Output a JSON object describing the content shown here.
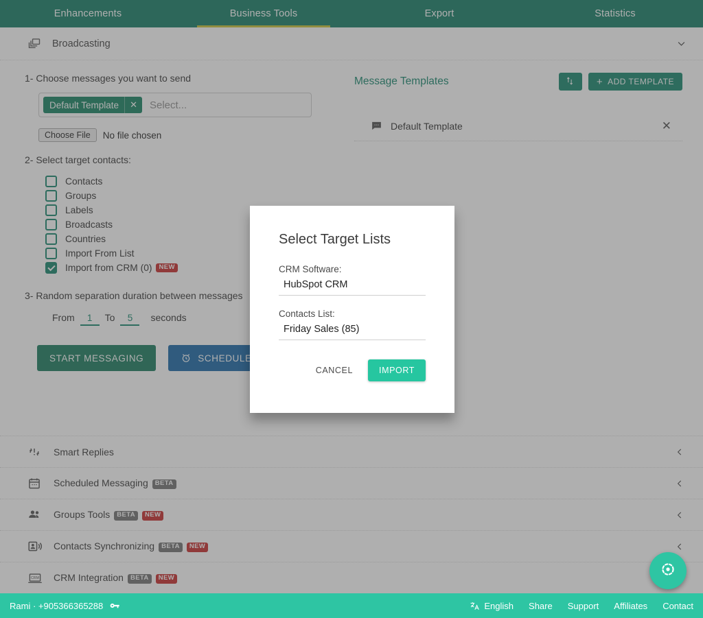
{
  "nav": {
    "tabs": [
      {
        "label": "Enhancements",
        "active": false
      },
      {
        "label": "Business Tools",
        "active": true
      },
      {
        "label": "Export",
        "active": false
      },
      {
        "label": "Statistics",
        "active": false
      }
    ]
  },
  "broadcasting": {
    "title": "Broadcasting",
    "icon": "broadcast-icon",
    "chevron": "chevron-down-icon",
    "step1_label": "1- Choose messages you want to send",
    "template_chip": "Default Template",
    "select_placeholder": "Select...",
    "choose_file_label": "Choose File",
    "no_file_text": "No file chosen",
    "step2_label": "2- Select target contacts:",
    "targets": [
      {
        "label": "Contacts",
        "checked": false,
        "badge": ""
      },
      {
        "label": "Groups",
        "checked": false,
        "badge": ""
      },
      {
        "label": "Labels",
        "checked": false,
        "badge": ""
      },
      {
        "label": "Broadcasts",
        "checked": false,
        "badge": ""
      },
      {
        "label": "Countries",
        "checked": false,
        "badge": ""
      },
      {
        "label": "Import From List",
        "checked": false,
        "badge": ""
      },
      {
        "label": "Import from CRM (0)",
        "checked": true,
        "badge": "NEW"
      }
    ],
    "step3_label": "3- Random separation duration between messages",
    "from_label": "From",
    "from_value": "1",
    "to_label": "To",
    "to_value": "5",
    "seconds_label": "seconds",
    "start_button": "START MESSAGING",
    "schedule_button": "SCHEDULE FOR LATER",
    "schedule_icon": "alarm-clock-icon"
  },
  "templates": {
    "title": "Message Templates",
    "sort_icon": "sort-arrows-icon",
    "add_label": "ADD TEMPLATE",
    "items": [
      {
        "name": "Default Template",
        "icon": "message-icon",
        "remove_icon": "close-icon"
      }
    ]
  },
  "accordions": [
    {
      "label": "Smart Replies",
      "icon": "smart-replies-icon",
      "badges": []
    },
    {
      "label": "Scheduled Messaging",
      "icon": "calendar-icon",
      "badges": [
        "BETA"
      ]
    },
    {
      "label": "Groups Tools",
      "icon": "groups-icon",
      "badges": [
        "BETA",
        "NEW"
      ]
    },
    {
      "label": "Contacts Synchronizing",
      "icon": "contact-sync-icon",
      "badges": [
        "BETA",
        "NEW"
      ]
    },
    {
      "label": "CRM Integration",
      "icon": "crm-laptop-icon",
      "badges": [
        "BETA",
        "NEW"
      ]
    }
  ],
  "modal": {
    "title": "Select Target Lists",
    "crm_label": "CRM Software:",
    "crm_value": "HubSpot CRM",
    "list_label": "Contacts List:",
    "list_value": "Friday Sales (85)",
    "cancel_label": "CANCEL",
    "import_label": "IMPORT"
  },
  "fab": {
    "icon": "adjust-target-icon"
  },
  "statusbar": {
    "user": "Rami · +905366365288",
    "key_icon": "key-icon",
    "language_icon": "translate-icon",
    "links": [
      "English",
      "Share",
      "Support",
      "Affiliates",
      "Contact"
    ]
  },
  "colors": {
    "nav_bg": "#0f7a63",
    "nav_active_underline": "#c8c232",
    "accent_green": "#12836a",
    "accent_mint": "#2ec5a3",
    "blue_button": "#1565a5",
    "badge_new": "#c62828",
    "badge_beta": "#6f6f6f"
  }
}
